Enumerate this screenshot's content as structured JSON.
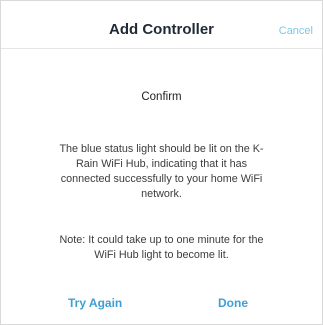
{
  "header": {
    "title": "Add Controller",
    "cancel_label": "Cancel"
  },
  "dialog": {
    "heading": "Confirm",
    "message_lines": [
      "The blue status light should be lit on the K-",
      "Rain WiFi Hub, indicating that it has",
      "connected successfully to your home WiFi",
      "network."
    ],
    "note_lines": [
      "Note: It could take up to one minute for the",
      "WiFi Hub light to become lit."
    ]
  },
  "actions": {
    "try_again_label": "Try Again",
    "done_label": "Done"
  },
  "colors": {
    "accent": "#3f9fd4",
    "cancel": "#7dc6ea",
    "title": "#1f2a36"
  }
}
